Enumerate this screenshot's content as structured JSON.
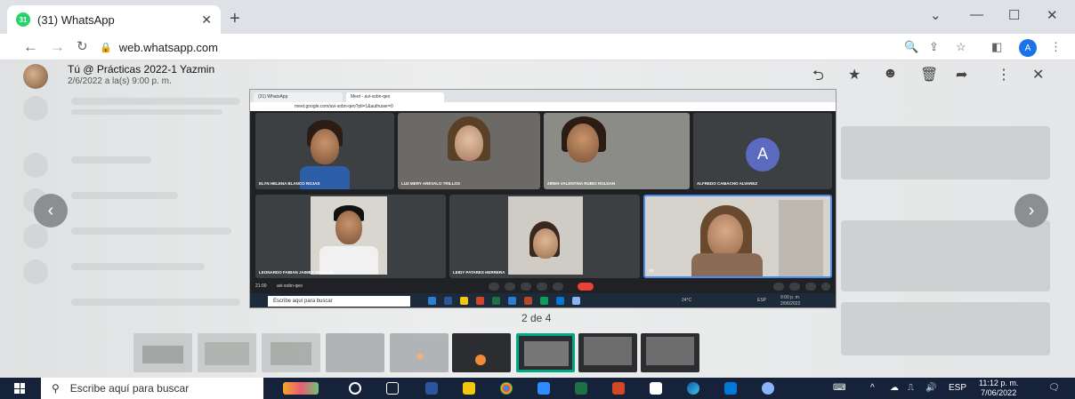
{
  "browser": {
    "tab_title": "(31) WhatsApp",
    "tab_badge": "31",
    "url": "web.whatsapp.com",
    "profile_initial": "A"
  },
  "viewer": {
    "sender": "Tú @ Prácticas 2022-1 Yazmin",
    "date": "2/6/2022 a la(s) 9:00 p. m.",
    "counter": "2 de 4"
  },
  "shot": {
    "tab1": "(31) WhatsApp",
    "tab2": "Meet - avi-sobn-qeo",
    "url": "meet.google.com/avi-sobn-qeo?pli=1&authuser=0",
    "participants": [
      {
        "name": "ELYN HELENA BLANCO ROJAS"
      },
      {
        "name": "LUZ MERY AREVALO TRILLOS"
      },
      {
        "name": "ZIREH VALENTINA RUBIO ROLDAN"
      },
      {
        "name": "ALFREDO CAMACHO ALVAREZ",
        "initial": "A"
      },
      {
        "name": "LEONARDO FABIAN JAIMES VILLALEL"
      },
      {
        "name": "LEIDY PATARES HERRERA"
      },
      {
        "name": "Tú"
      }
    ],
    "meeting_time": "21:00",
    "meeting_code": "avi-sobn-qeo",
    "search_placeholder": "Escribe aquí para buscar",
    "weather": "24°C",
    "lang": "ESP",
    "time": "9:00 p. m.",
    "date": "2/06/2022"
  },
  "taskbar": {
    "search_placeholder": "Escribe aquí para buscar",
    "lang": "ESP",
    "time": "11:12 p. m.",
    "date": "7/06/2022"
  }
}
